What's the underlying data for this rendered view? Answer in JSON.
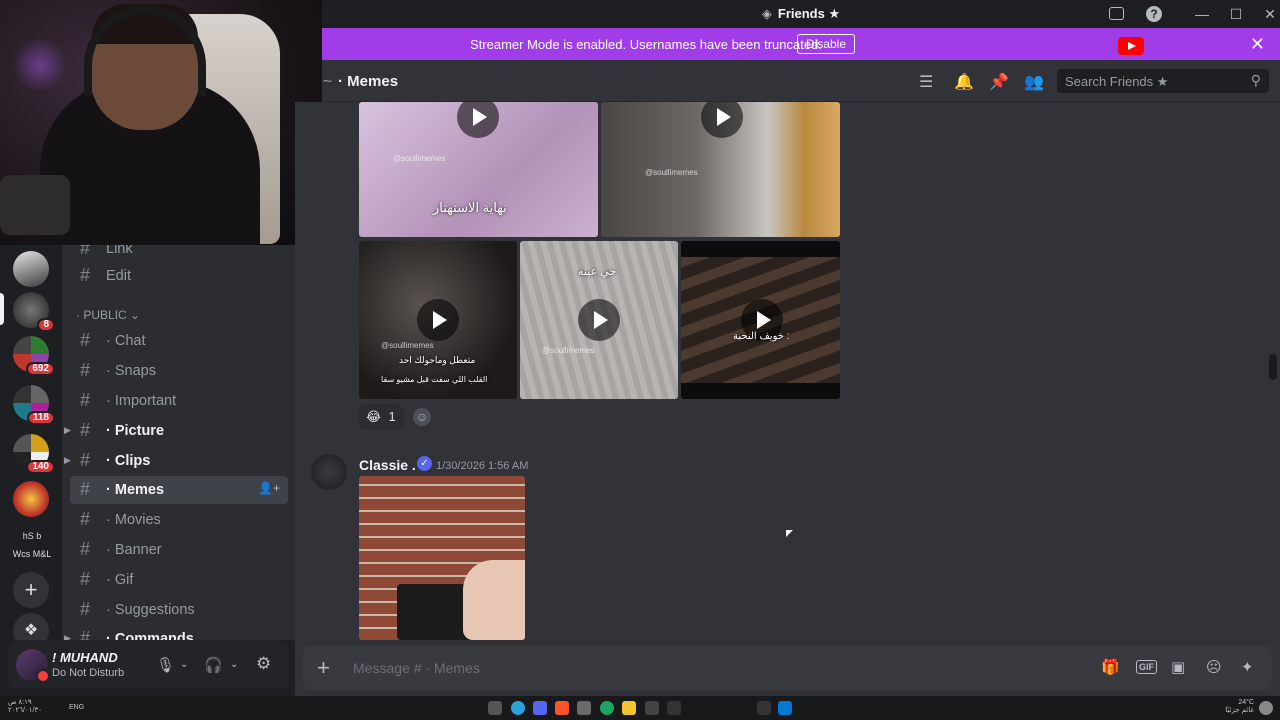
{
  "window": {
    "title": "Friends ★",
    "title_icon": "discord-glyph"
  },
  "banner": {
    "text": "Streamer Mode is enabled. Usernames have been truncated.",
    "button": "Disable",
    "bg": "#a13de8"
  },
  "servers": {
    "badges": [
      "8",
      "692",
      "118",
      "140"
    ],
    "text_server_line1": "hS  b",
    "text_server_line2": "Wcs M&L"
  },
  "channels": {
    "top_partial": "Link",
    "edit": "Edit",
    "category": "PUBLIC",
    "items": [
      {
        "label": "Chat"
      },
      {
        "label": "Snaps"
      },
      {
        "label": "Important"
      },
      {
        "label": "Picture"
      },
      {
        "label": "Clips"
      },
      {
        "label": "Memes"
      },
      {
        "label": "Movies"
      },
      {
        "label": "Banner"
      },
      {
        "label": "Gif"
      },
      {
        "label": "Suggestions"
      },
      {
        "label": "Commands"
      }
    ]
  },
  "user": {
    "name": "! MUHAND",
    "status": "Do Not Disturb"
  },
  "chat": {
    "channel_name": "Memes",
    "search_placeholder": "Search Friends ★",
    "tiles": [
      {
        "caption": "نهاية الاستهتار",
        "watermark": "@soullimemes"
      },
      {
        "caption": "",
        "watermark": "@soullimemes"
      },
      {
        "caption": "متعطل وماحولك احد",
        "caption2": "القلب اللي سفت قبل مشيو سقا",
        "watermark": "@soullimemes"
      },
      {
        "caption": "حي عينه",
        "watermark": "@soullimemes"
      },
      {
        "caption": "خويف النحبة :",
        "watermark": ""
      }
    ],
    "reaction_emoji": "😂",
    "reaction_count": "1",
    "message": {
      "author": "Classie .",
      "timestamp": "1/30/2026 1:56 AM"
    },
    "composer_placeholder": "Message # · Memes"
  },
  "taskbar": {
    "time_left": "٨:١٩ ص",
    "date_left": "٢٠٢٦/٠١/٣٠",
    "lang": "ENG",
    "temp": "24°C",
    "weather": "غائم جزئيًا"
  }
}
